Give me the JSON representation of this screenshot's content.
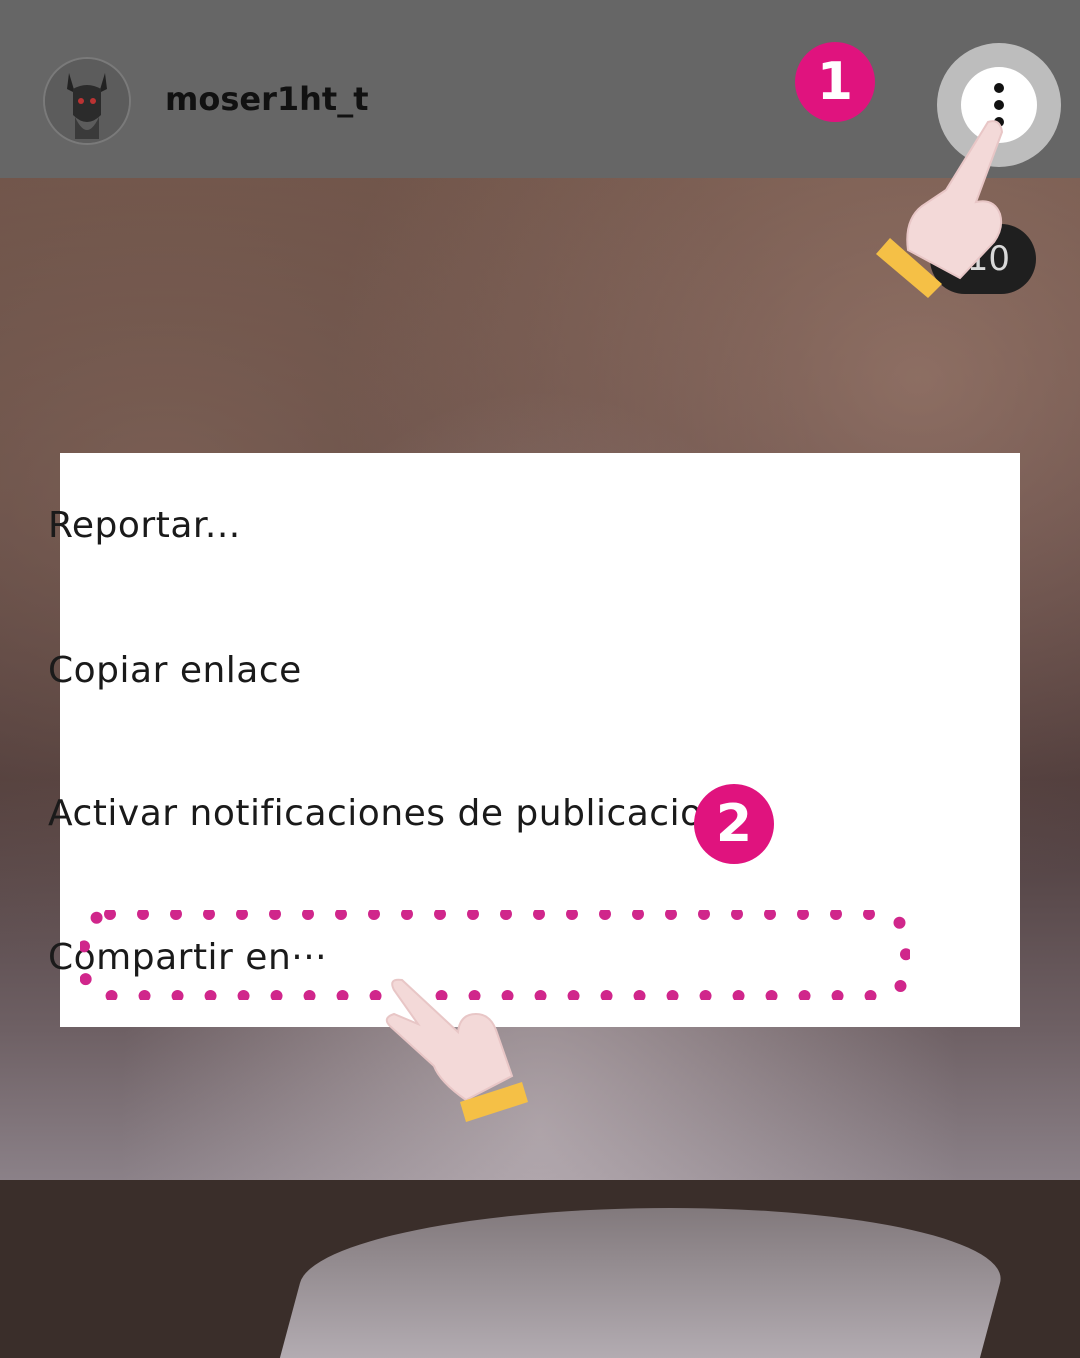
{
  "header": {
    "username": "moser1ht_t",
    "avatar_icon": "avatar-icon",
    "more_options_icon": "more-vertical-icon"
  },
  "photo": {
    "counter": "/10"
  },
  "annotations": {
    "step1": "1",
    "step2": "2",
    "accent_color": "#e0137e"
  },
  "menu": {
    "items": [
      {
        "label": "Reportar..."
      },
      {
        "label": "Copiar enlace"
      },
      {
        "label": "Activar notificaciones de publicaciones"
      },
      {
        "label": "Compartir en···"
      }
    ]
  }
}
